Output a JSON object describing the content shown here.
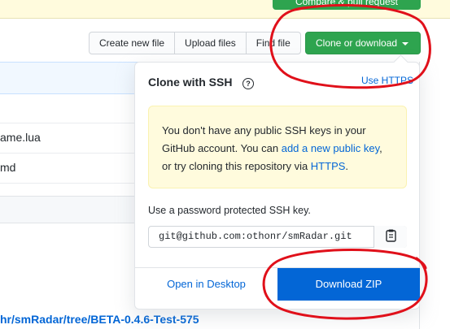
{
  "banner": {
    "compare_label": "Compare & pull request"
  },
  "toolbar": {
    "create_new_file": "Create new file",
    "upload_files": "Upload files",
    "find_file": "Find file",
    "clone_or_download": "Clone or download"
  },
  "files": {
    "rows": [
      "ame.lua",
      "md"
    ]
  },
  "bottom_link": "hr/smRadar/tree/BETA-0.4.6-Test-575",
  "clone_dropdown": {
    "title": "Clone with SSH",
    "help_icon": "question-circle-icon",
    "use_https": "Use HTTPS",
    "notice_part1": "You don't have any public SSH keys in your GitHub account. You can ",
    "notice_link1": "add a new public key",
    "notice_part2": ", or try cloning this repository via ",
    "notice_link2": "HTTPS",
    "notice_part3": ".",
    "ssh_label": "Use a password protected SSH key.",
    "ssh_url": "git@github.com:othonr/smRadar.git",
    "copy_icon": "clipboard-icon",
    "open_desktop": "Open in Desktop",
    "download_zip": "Download ZIP"
  },
  "colors": {
    "primary_green": "#2ea44f",
    "link_blue": "#0366d6",
    "notice_yellow": "#fffbdd",
    "annotation_red": "#e0101a"
  }
}
